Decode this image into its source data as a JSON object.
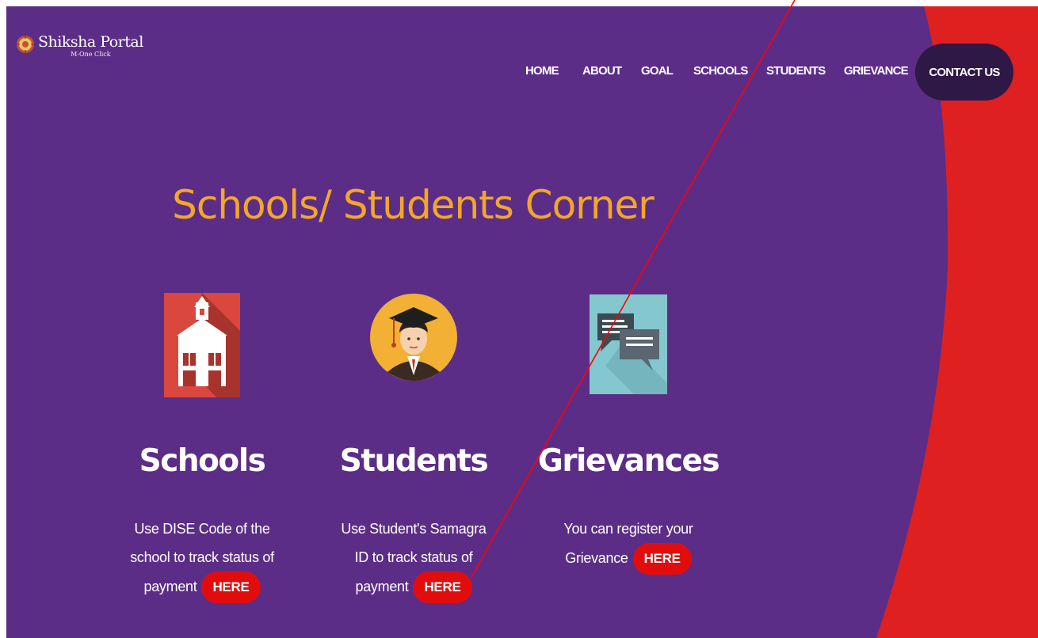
{
  "brand": {
    "name": "Shiksha Portal",
    "tagline": "M-One Click"
  },
  "nav": {
    "items": [
      {
        "label": "HOME"
      },
      {
        "label": "ABOUT"
      },
      {
        "label": "GOAL"
      },
      {
        "label": "SCHOOLS"
      },
      {
        "label": "STUDENTS"
      },
      {
        "label": "GRIEVANCE"
      }
    ],
    "contact_label": "CONTACT US"
  },
  "page_title": "Schools/ Students Corner",
  "cards": [
    {
      "icon": "school-house-icon",
      "heading": "Schools",
      "lines": [
        "Use DISE Code of the",
        "school to track status of",
        "payment"
      ],
      "button": "HERE"
    },
    {
      "icon": "graduate-icon",
      "heading": "Students",
      "lines": [
        "Use Student's Samagra",
        "ID to track status of",
        "payment"
      ],
      "button": "HERE"
    },
    {
      "icon": "chat-bubbles-icon",
      "heading": "Grievances",
      "lines": [
        "You can register your",
        "Grievance"
      ],
      "button": "HERE"
    }
  ],
  "colors": {
    "background": "#5c2d87",
    "accent_red": "#de2020",
    "title_orange": "#f2a72a",
    "contact_bg": "#2e1846",
    "here_button": "#e10d0d"
  }
}
